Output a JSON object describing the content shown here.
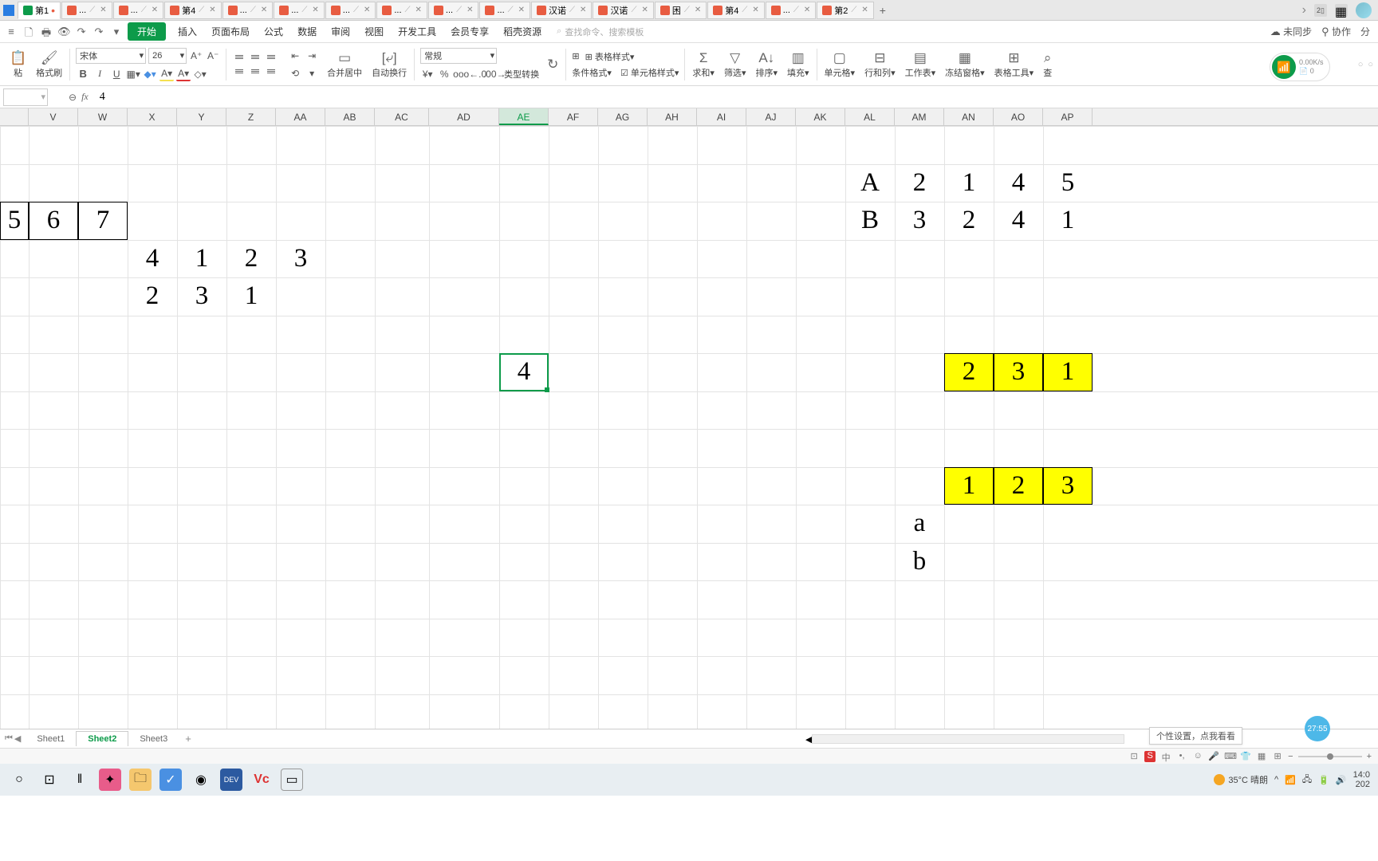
{
  "tabs": {
    "active": "第1",
    "items": [
      "第1",
      "...",
      "...",
      "第4",
      "...",
      "...",
      "...",
      "...",
      "...",
      "...",
      "汉诺",
      "汉诺",
      "困",
      "第4",
      "...",
      "第2"
    ]
  },
  "menu": {
    "start": "开始",
    "items": [
      "插入",
      "页面布局",
      "公式",
      "数据",
      "审阅",
      "视图",
      "开发工具",
      "会员专享",
      "稻壳资源"
    ],
    "search_ph": "查找命令、搜索模板",
    "right": {
      "sync": "未同步",
      "collab": "协作",
      "share": "分"
    }
  },
  "ribbon": {
    "paste": "粘",
    "format_painter": "格式刷",
    "font": "宋体",
    "size": "26",
    "format": "常规",
    "merge": "合并居中",
    "wrap": "自动换行",
    "type": "类型转换",
    "cond": "条件格式",
    "table_style": "表格样式",
    "cell_style": "单元格样式",
    "sum": "求和",
    "filter": "筛选",
    "sort": "排序",
    "fill": "填充",
    "cell": "单元格",
    "rowcol": "行和列",
    "sheet": "工作表",
    "freeze": "冻结窗格",
    "tools": "表格工具",
    "find": "查"
  },
  "wifi": {
    "speed": "0.00K/s",
    "count": "0"
  },
  "formula": {
    "cell": "",
    "fx": "fx",
    "value": "4"
  },
  "cols": [
    "",
    "V",
    "W",
    "X",
    "Y",
    "Z",
    "AA",
    "AB",
    "AC",
    "AD",
    "AE",
    "AF",
    "AG",
    "AH",
    "AI",
    "AJ",
    "AK",
    "AL",
    "AM",
    "AN",
    "AO",
    "AP"
  ],
  "cells": {
    "r3": {
      "V": "6",
      "W": "7"
    },
    "r4": {
      "X": "4",
      "Y": "1",
      "Z": "2",
      "AA": "3"
    },
    "r5": {
      "X": "2",
      "Y": "3",
      "Z": "1"
    },
    "r2b": {
      "AL": "A",
      "AM": "2",
      "AN": "1",
      "AO": "4",
      "AP": "5"
    },
    "r3b": {
      "AL": "B",
      "AM": "3",
      "AN": "2",
      "AO": "4",
      "AP": "1"
    },
    "sel": {
      "AE": "4"
    },
    "y1": {
      "AN": "2",
      "AO": "3",
      "AP": "1"
    },
    "y2": {
      "AN": "1",
      "AO": "2",
      "AP": "3"
    },
    "ab": {
      "a": "a",
      "b": "b"
    }
  },
  "sheets": {
    "items": [
      "Sheet1",
      "Sheet2",
      "Sheet3"
    ],
    "active": "Sheet2"
  },
  "tip": "个性设置，点我看看",
  "timer": "27:55",
  "os": {
    "weather": "35°C 晴朗",
    "time": "14:0",
    "date": "202"
  }
}
